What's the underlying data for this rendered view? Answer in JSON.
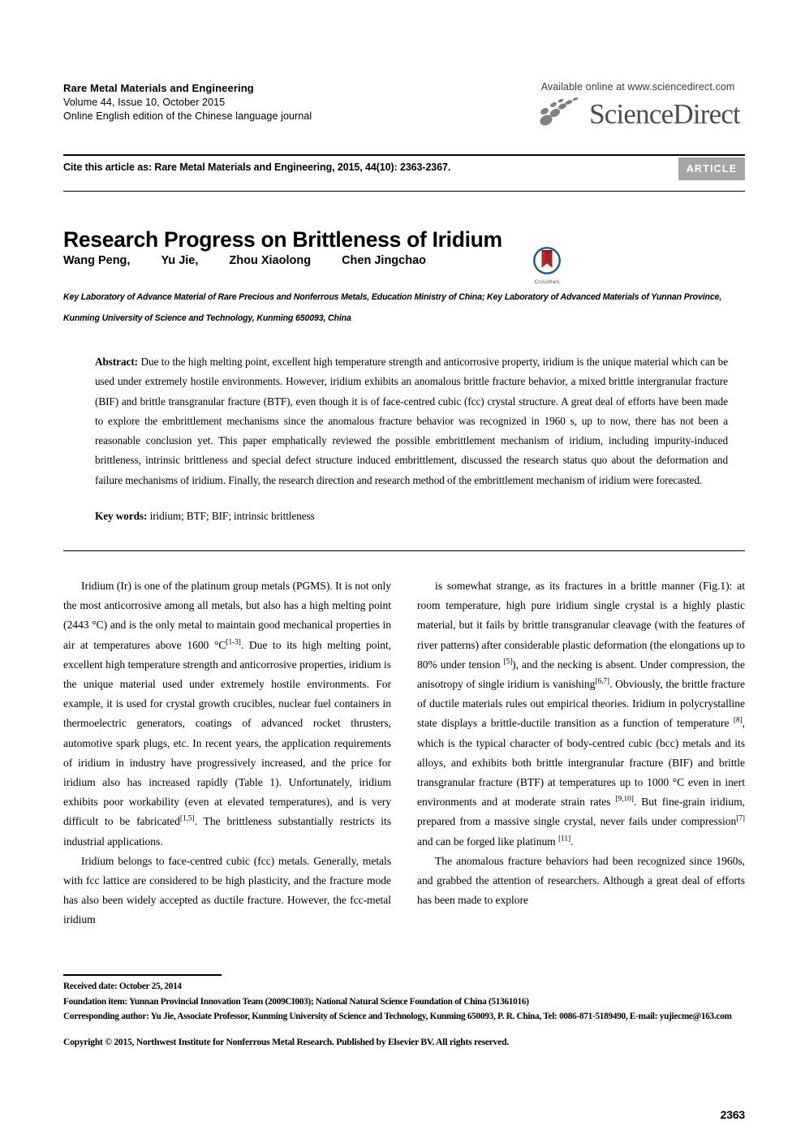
{
  "masthead": {
    "journal_name": "Rare Metal Materials and Engineering",
    "volume_line": "Volume 44, Issue 10, October 2015",
    "edition_line": "Online English edition of the Chinese language journal",
    "available_online": "Available online at www.sciencedirect.com",
    "sciencedirect_wordmark": "ScienceDirect"
  },
  "citation": {
    "cite_text": "Cite this article as: Rare Metal Materials and Engineering, 2015, 44(10): 2363-2367.",
    "article_badge": "ARTICLE",
    "badge_color": "#a6a6a6"
  },
  "article": {
    "title": "Research Progress on Brittleness of Iridium",
    "authors": [
      "Wang Peng,",
      "Yu Jie,",
      "Zhou Xiaolong",
      "Chen Jingchao"
    ],
    "crossmark_label": "CrossMark",
    "affiliation": "Key Laboratory of Advance Material of Rare Precious and Nonferrous Metals, Education Ministry of China; Key Laboratory of Advanced Materials of Yunnan Province, Kunming University of Science and Technology, Kunming 650093, China"
  },
  "abstract": {
    "heading": "Abstract:",
    "body": " Due to the high melting point, excellent high temperature strength and anticorrosive property, iridium is the unique material which can be used under extremely hostile environments. However, iridium exhibits an anomalous brittle fracture behavior, a mixed brittle intergranular fracture (BIF) and brittle transgranular fracture (BTF), even though it is of face-centred cubic (fcc) crystal structure. A great deal of efforts have been made to explore the embrittlement mechanisms since the anomalous fracture behavior was recognized in 1960 s, up to now, there has not been a reasonable conclusion yet. This paper emphatically reviewed the possible embrittlement mechanism of iridium, including impurity-induced brittleness, intrinsic brittleness and special defect structure induced embrittlement, discussed the research status quo about the deformation and failure mechanisms of iridium. Finally, the research direction and research method of the embrittlement mechanism of iridium were forecasted."
  },
  "keywords": {
    "heading": "Key words:",
    "body": " iridium; BTF; BIF; intrinsic brittleness"
  },
  "body": {
    "left_column": [
      {
        "text_parts": [
          "Iridium (Ir) is one of the platinum group metals (PGMS). It is not only the most anticorrosive among all metals, but also has a high melting point (2443 °C) and is the only metal to maintain good mechanical properties in air at temperatures above 1600 °C",
          "[1-3]",
          ". Due to its high melting point, excellent high temperature strength and anticorrosive properties, iridium is the unique material used under extremely hostile environments. For example, it is used for crystal growth crucibles, nuclear fuel containers in thermoelectric generators, coatings of advanced rocket thrusters, automotive spark plugs, etc. In recent years, the application requirements of iridium in industry have progressively increased, and the price for iridium also has increased rapidly (Table 1). Unfortunately, iridium exhibits poor workability (even at elevated temperatures), and is very difficult to be fabricated",
          "[1,5]",
          ". The brittleness substantially restricts its industrial applications."
        ]
      },
      {
        "text_parts": [
          "Iridium belongs to face-centred cubic (fcc) metals. Generally, metals with fcc lattice are considered to be high plasticity, and the fracture mode has also been widely accepted as ductile fracture. However, the fcc-metal iridium"
        ]
      }
    ],
    "right_column": [
      {
        "text_parts": [
          "is somewhat strange, as its fractures in a brittle manner (Fig.1): at room temperature, high pure iridium single crystal is a highly plastic material, but it fails by brittle transgranular cleavage (with the features of river patterns) after considerable plastic deformation (the elongations up to 80% under tension ",
          "[5]",
          "), and the necking is absent. Under compression, the anisotropy of single iridium is vanishing",
          "[6,7]",
          ". Obviously, the brittle fracture of ductile materials rules out empirical theories. Iridium in polycrystalline state displays a brittle-ductile transition as a function of temperature ",
          "[8]",
          ", which is the typical character of body-centred cubic (bcc) metals and its alloys, and exhibits both brittle intergranular fracture (BIF) and brittle transgranular fracture (BTF) at temperatures up to 1000 °C even in inert environments and at moderate strain rates ",
          "[9,10]",
          ". But fine-grain iridium, prepared from a massive single crystal, never fails under compression",
          "[7]",
          " and can be forged like platinum ",
          "[11]",
          "."
        ]
      },
      {
        "text_parts": [
          "The anomalous fracture behaviors had been recognized since 1960s, and grabbed the attention of researchers. Although a great deal of efforts has been made to explore"
        ]
      }
    ]
  },
  "footer": {
    "received": "Received date: October 25, 2014",
    "foundation": "Foundation item: Yunnan Provincial Innovation Team (2009CI003); National Natural Science Foundation of China (51361016)",
    "corresponding": "Corresponding author: Yu Jie, Associate Professor, Kunming University of Science and Technology, Kunming 650093, P. R. China, Tel: 0086-871-5189490, E-mail: yujiecme@163.com",
    "copyright": "Copyright © 2015, Northwest Institute for Nonferrous Metal Research. Published by Elsevier BV. All rights reserved.",
    "page_number": "2363"
  }
}
